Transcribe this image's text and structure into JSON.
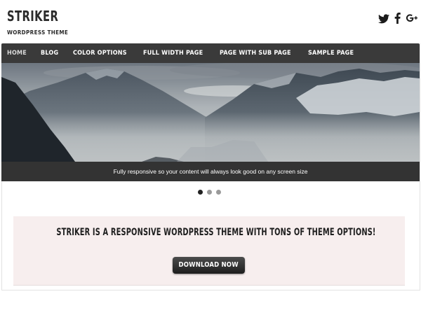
{
  "site": {
    "title": "STRIKER",
    "tagline": "WORDPRESS THEME"
  },
  "social": [
    {
      "icon": "twitter-icon"
    },
    {
      "icon": "facebook-icon"
    },
    {
      "icon": "google-plus-icon"
    }
  ],
  "nav": {
    "items": [
      {
        "label": "HOME",
        "active": true
      },
      {
        "label": "BLOG"
      },
      {
        "label": "COLOR OPTIONS"
      },
      {
        "label": "FULL WIDTH PAGE"
      },
      {
        "label": "PAGE WITH SUB PAGE"
      },
      {
        "label": "SAMPLE PAGE"
      }
    ]
  },
  "slider": {
    "caption": "Fully responsive so your content will always look good on any screen size",
    "slide_count": 3,
    "active_slide": 1
  },
  "cta": {
    "heading": "STRIKER IS A RESPONSIVE WORDPRESS THEME WITH TONS OF THEME OPTIONS!",
    "button_label": "DOWNLOAD NOW"
  },
  "colors": {
    "nav_bg": "#3a3a3a",
    "cta_bg": "#f7eeee",
    "caption_bg": "#333333"
  }
}
